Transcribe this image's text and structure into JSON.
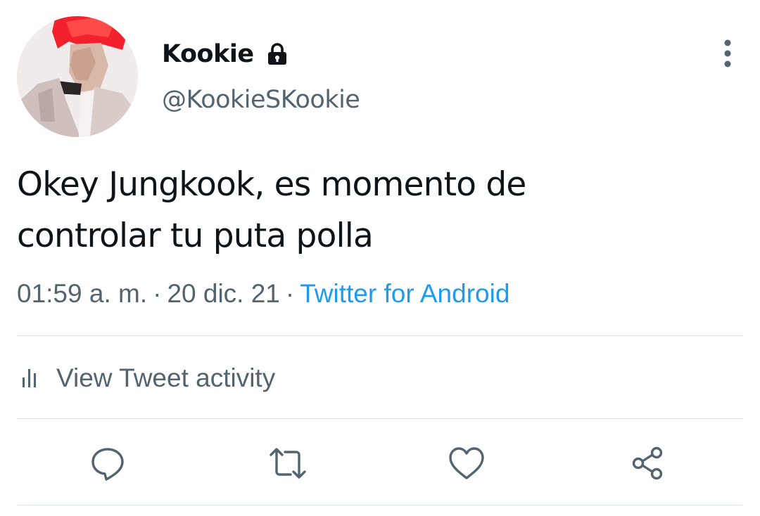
{
  "author": {
    "display_name": "Kookie",
    "handle": "@KookieSKookie",
    "avatar_icon": "profile-photo",
    "protected_icon": "lock-icon"
  },
  "tweet": {
    "text_line1": "Okey Jungkook, es momento de",
    "text_line2": "controlar tu puta polla"
  },
  "meta": {
    "time": "01:59 a. m.",
    "separator": "·",
    "date": "20 dic. 21",
    "source": "Twitter for Android"
  },
  "activity": {
    "label": "View Tweet activity",
    "icon": "stats-icon"
  },
  "actions": {
    "reply_icon": "reply-icon",
    "retweet_icon": "retweet-icon",
    "like_icon": "heart-icon",
    "share_icon": "share-icon"
  },
  "colors": {
    "text_primary": "#0f1419",
    "text_secondary": "#536471",
    "link": "#1d9bf0",
    "divider": "#dfe4e8"
  }
}
